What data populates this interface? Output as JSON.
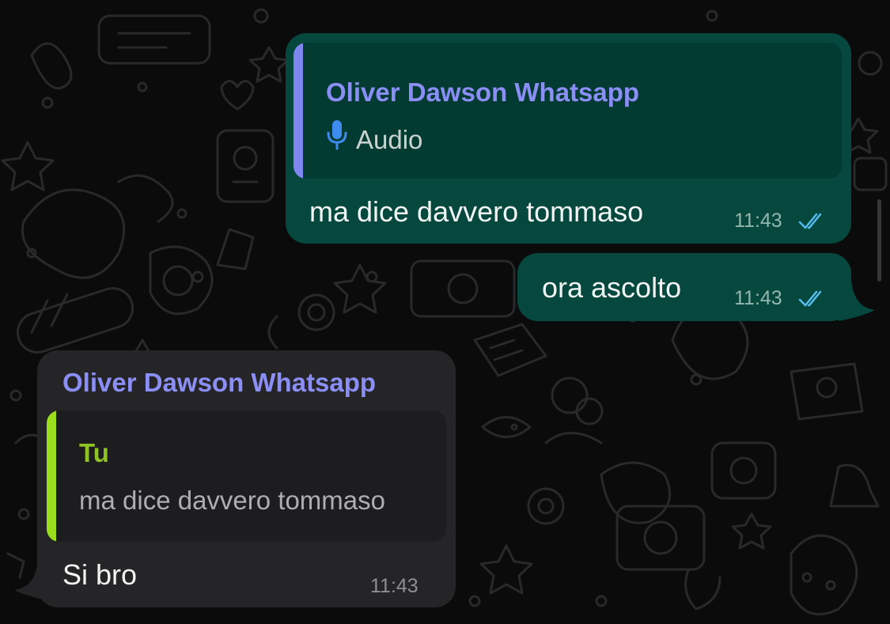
{
  "chat": {
    "messages": [
      {
        "direction": "outgoing",
        "reply_to": {
          "author": "Oliver Dawson Whatsapp",
          "icon": "microphone-icon",
          "preview": "Audio"
        },
        "text": "ma dice davvero tommaso",
        "time": "11:43",
        "status": "read"
      },
      {
        "direction": "outgoing",
        "text": "ora ascolto",
        "time": "11:43",
        "status": "read"
      },
      {
        "direction": "incoming",
        "sender": "Oliver Dawson Whatsapp",
        "reply_to": {
          "author": "Tu",
          "preview": "ma dice davvero tommaso"
        },
        "text": "Si bro",
        "time": "11:43"
      }
    ]
  },
  "colors": {
    "background": "#0b0b0c",
    "outgoing_bubble": "#06483e",
    "outgoing_quote": "#033a32",
    "incoming_bubble": "#252527",
    "incoming_quote": "#1d1d1f",
    "sender_name": "#8b8ff5",
    "quote_bar_outgoing": "#7f86ef",
    "quote_bar_incoming": "#9ade1d",
    "own_author_label": "#8fc223",
    "read_ticks": "#53bdeb"
  }
}
